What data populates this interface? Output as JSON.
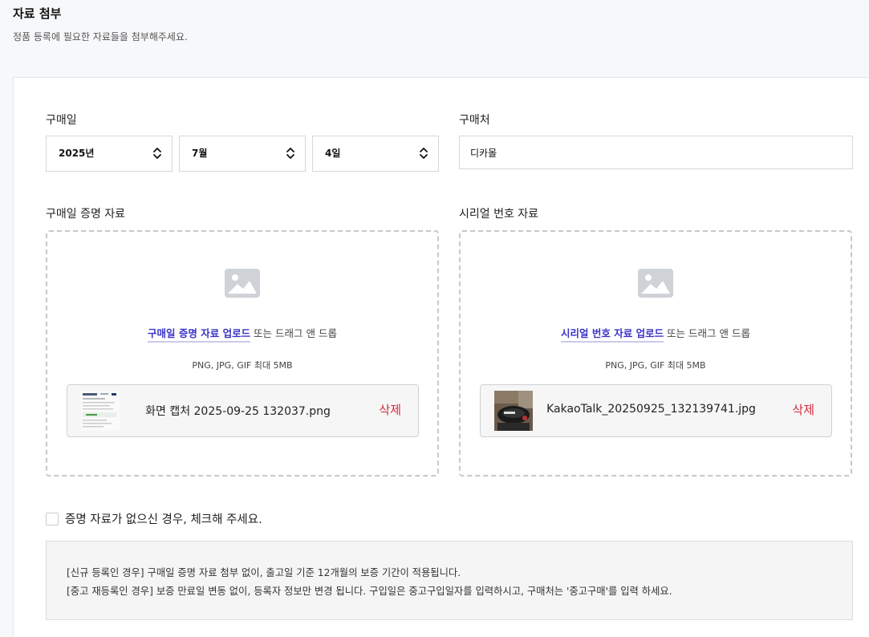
{
  "header": {
    "title": "자료 첨부",
    "description": "정품 등록에 필요한 자료들을 첨부해주세요."
  },
  "purchase_date": {
    "label": "구매일",
    "year": "2025년",
    "month": "7월",
    "day": "4일"
  },
  "purchase_place": {
    "label": "구매처",
    "value": "디카몰"
  },
  "proof_upload": {
    "label": "구매일 증명 자료",
    "link_text": "구매일 증명 자료 업로드",
    "suffix": " 또는 드래그 앤 드롭",
    "hint": "PNG, JPG, GIF 최대 5MB",
    "file_name": "화면 캡처 2025-09-25 132037.png",
    "delete_label": "삭제"
  },
  "serial_upload": {
    "label": "시리얼 번호 자료",
    "link_text": "시리얼 번호 자료 업로드",
    "suffix": " 또는 드래그 앤 드롭",
    "hint": "PNG, JPG, GIF 최대 5MB",
    "file_name": "KakaoTalk_20250925_132139741.jpg",
    "delete_label": "삭제"
  },
  "no_proof_checkbox": {
    "label": "증명 자료가 없으신 경우, 체크해 주세요."
  },
  "notice": {
    "line1": "[신규 등록인 경우] 구매일 증명 자료 첨부 없이, 출고일 기준 12개월의 보증 기간이 적용됩니다.",
    "line2": "[중고 재등록인 경우] 보증 만료일 변동 없이, 등록자 정보만 변경 됩니다. 구입일은 중고구입일자를 입력하시고, 구매처는 '중고구매'를 입력 하세요."
  },
  "colors": {
    "link": "#3b34c8",
    "delete": "#d6283a"
  }
}
